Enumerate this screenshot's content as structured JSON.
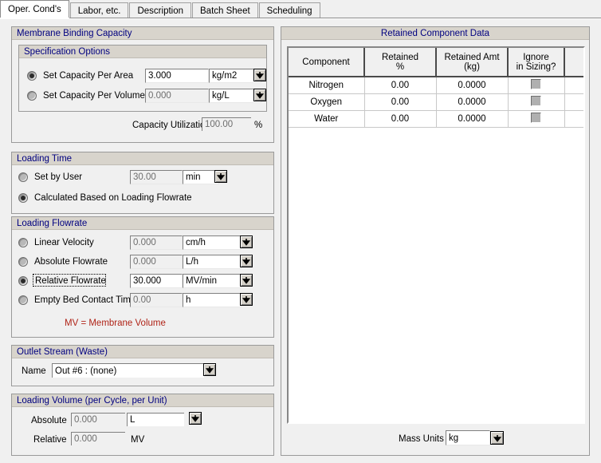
{
  "tabs": [
    {
      "label": "Oper. Cond's",
      "active": true
    },
    {
      "label": "Labor, etc.",
      "active": false
    },
    {
      "label": "Description",
      "active": false
    },
    {
      "label": "Batch Sheet",
      "active": false
    },
    {
      "label": "Scheduling",
      "active": false
    }
  ],
  "membrane_binding_capacity": {
    "title": "Membrane Binding Capacity",
    "specification_options": {
      "title": "Specification Options",
      "per_area": {
        "label": "Set Capacity Per Area",
        "selected": true,
        "value": "3.000",
        "unit": "kg/m2"
      },
      "per_volume": {
        "label": "Set Capacity Per Volume",
        "selected": false,
        "value": "0.000",
        "unit": "kg/L"
      }
    },
    "capacity_utilization": {
      "label": "Capacity Utilization",
      "value": "100.00",
      "unit": "%"
    }
  },
  "loading_time": {
    "title": "Loading Time",
    "set_by_user": {
      "label": "Set by User",
      "selected": false,
      "value": "30.00",
      "unit": "min"
    },
    "calculated": {
      "label": "Calculated Based on Loading Flowrate",
      "selected": true
    }
  },
  "loading_flowrate": {
    "title": "Loading Flowrate",
    "options": [
      {
        "label": "Linear Velocity",
        "selected": false,
        "value": "0.000",
        "unit": "cm/h",
        "focused": false
      },
      {
        "label": "Absolute Flowrate",
        "selected": false,
        "value": "0.000",
        "unit": "L/h",
        "focused": false
      },
      {
        "label": "Relative Flowrate",
        "selected": true,
        "value": "30.000",
        "unit": "MV/min",
        "focused": true
      },
      {
        "label": "Empty Bed Contact Time",
        "selected": false,
        "value": "0.00",
        "unit": "h",
        "focused": false
      }
    ],
    "note": "MV = Membrane Volume"
  },
  "outlet_stream": {
    "title": "Outlet Stream (Waste)",
    "name_label": "Name",
    "name_value": "Out #6 : (none)"
  },
  "loading_volume": {
    "title": "Loading Volume (per Cycle, per Unit)",
    "absolute": {
      "label": "Absolute",
      "value": "0.000",
      "unit": "L"
    },
    "relative": {
      "label": "Relative",
      "value": "0.000",
      "unit": "MV"
    }
  },
  "retained_component_data": {
    "title": "Retained Component Data",
    "columns": [
      {
        "line1": "Component",
        "line2": ""
      },
      {
        "line1": "Retained",
        "line2": "%"
      },
      {
        "line1": "Retained Amt",
        "line2": "(kg)"
      },
      {
        "line1": "Ignore",
        "line2": "in Sizing?"
      },
      {
        "line1": "",
        "line2": ""
      }
    ],
    "rows": [
      {
        "component": "Nitrogen",
        "retained_pct": "0.00",
        "retained_amt": "0.0000",
        "ignore": false
      },
      {
        "component": "Oxygen",
        "retained_pct": "0.00",
        "retained_amt": "0.0000",
        "ignore": false
      },
      {
        "component": "Water",
        "retained_pct": "0.00",
        "retained_amt": "0.0000",
        "ignore": false
      }
    ],
    "mass_units": {
      "label": "Mass Units",
      "value": "kg"
    }
  },
  "icons": {
    "dropdown": "chevron-down-icon"
  },
  "colors": {
    "group_header_text": "#000080",
    "group_header_bg": "#d8d4cc",
    "panel_bg": "#f0f0f0",
    "note_text": "#b02418"
  }
}
